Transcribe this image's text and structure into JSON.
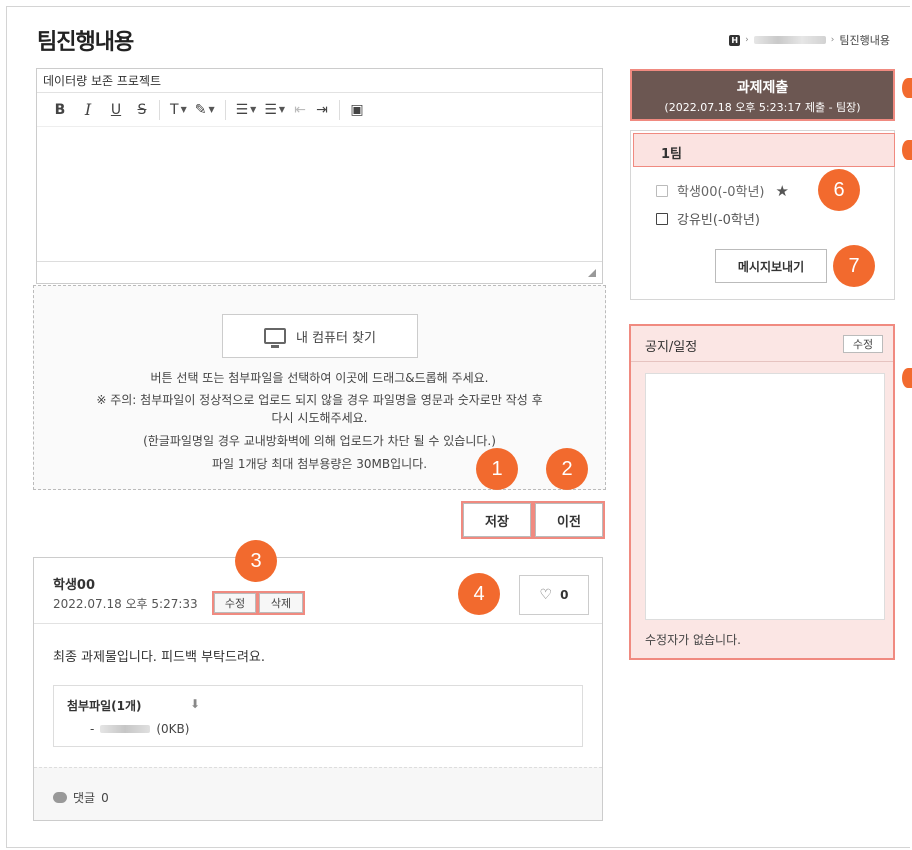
{
  "page": {
    "title": "팀진행내용"
  },
  "breadcrumb": {
    "home_icon": "home-icon",
    "current": "팀진행내용"
  },
  "editor": {
    "title": "데이터량 보존 프로젝트",
    "toolbar": {
      "bold": "B",
      "italic": "I",
      "underline": "U",
      "strike": "S",
      "font_size": "T",
      "highlight": "✎",
      "ordered_list": "☰",
      "unordered_list": "☰",
      "outdent": "⇤",
      "indent": "⇥",
      "image": "▣"
    }
  },
  "upload": {
    "button_label": "내 컴퓨터 찾기",
    "lines": [
      "버튼 선택 또는 첨부파일을 선택하여 이곳에 드래그&드롭해 주세요.",
      "※ 주의: 첨부파일이 정상적으로 업로드 되지 않을 경우 파일명을 영문과 숫자로만 작성 후",
      "다시 시도해주세요.",
      "(한글파일명일 경우 교내방화벽에 의해 업로드가 차단 될 수 있습니다.)",
      "파일 1개당 최대 첨부용량은 30MB입니다."
    ]
  },
  "actions": {
    "save": "저장",
    "prev": "이전"
  },
  "badges": [
    "1",
    "2",
    "3",
    "4",
    "6",
    "7"
  ],
  "post": {
    "author": "학생00",
    "date": "2022.07.18 오후 5:27:33",
    "edit": "수정",
    "delete": "삭제",
    "likes": "0",
    "body": "최종 과제물입니다. 피드백 부탁드려요.",
    "attach_title": "첨부파일(1개)",
    "file_prefix": "-",
    "file_size": "(0KB)",
    "comments_label": "댓글",
    "comments_count": "0"
  },
  "submit": {
    "label": "과제제출",
    "sub": "(2022.07.18 오후 5:23:17 제출 - 팀장)"
  },
  "team": {
    "name": "1팀",
    "members": [
      "학생00(-0학년)",
      "강유빈(-0학년)"
    ],
    "message_button": "메시지보내기"
  },
  "notice": {
    "title": "공지/일정",
    "edit": "수정",
    "footer": "수정자가 없습니다."
  },
  "colors": {
    "highlight": "#f08a80",
    "badge": "#f26a2e",
    "submit_bg": "#6c5752",
    "notice_bg": "#fbe6e4"
  }
}
